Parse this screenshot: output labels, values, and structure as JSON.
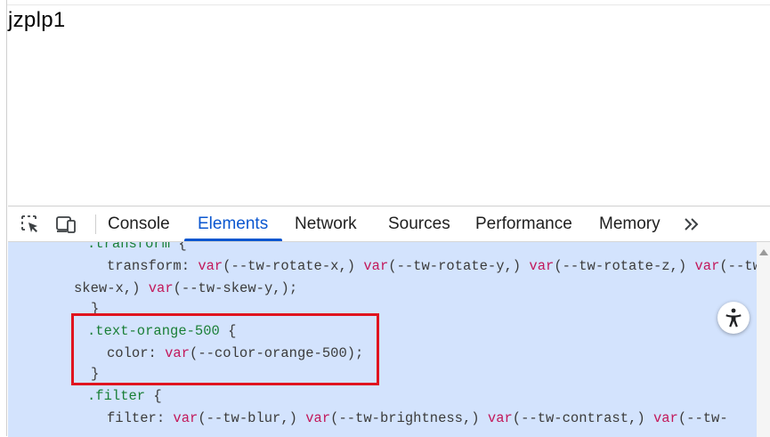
{
  "page": {
    "text": "jzplp1"
  },
  "devtools": {
    "tabs": [
      "Console",
      "Elements",
      "Network",
      "Sources",
      "Performance",
      "Memory"
    ],
    "active_tab": "Elements",
    "more_icon": "chevron-double-right-icon"
  },
  "code": {
    "l1_sel": ".transform",
    "l1_rest": " {",
    "l2_prop": "transform",
    "l2_colon": ": ",
    "l2_a": "var",
    "l2_b": "(--tw-rotate-x,) ",
    "l2_c": "var",
    "l2_d": "(--tw-rotate-y,) ",
    "l2_e": "var",
    "l2_f": "(--tw-rotate-z,) ",
    "l2_g": "var",
    "l2_h": "(--tw-",
    "l3_a": "skew-x,) ",
    "l3_b": "var",
    "l3_c": "(--tw-skew-y,);",
    "l4": "}",
    "l5_sel": ".text-orange-500",
    "l5_rest": " {",
    "l6_prop": "color",
    "l6_colon": ": ",
    "l6_kw": "var",
    "l6_val": "(--color-orange-500);",
    "l7": "}",
    "l8_sel": ".filter",
    "l8_rest": " {",
    "l9_prop": "filter",
    "l9_colon": ": ",
    "l9_a": "var",
    "l9_b": "(--tw-blur,) ",
    "l9_c": "var",
    "l9_d": "(--tw-brightness,) ",
    "l9_e": "var",
    "l9_f": "(--tw-contrast,) ",
    "l9_g": "var",
    "l9_h": "(--tw-"
  },
  "colors": {
    "accent": "#0b57d0",
    "selection_bg": "#d3e3fd",
    "highlight": "#e0141e",
    "selector": "#1a7f37",
    "keyword": "#c2185b"
  }
}
